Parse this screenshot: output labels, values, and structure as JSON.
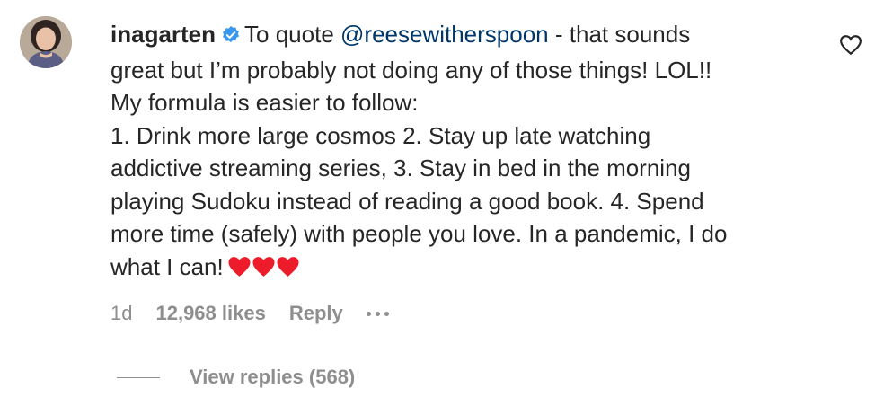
{
  "comment": {
    "username": "inagarten",
    "text_prefix": "To quote ",
    "mention": "@reesewitherspoon",
    "lines": [
      " - that sounds",
      "great but I’m probably not doing any of those things! LOL!!",
      "My formula is easier to follow:",
      "1. Drink more large cosmos 2. Stay up late watching",
      "addictive streaming series, 3. Stay in bed in the morning",
      "playing Sudoku instead of reading a good book. 4. Spend",
      "more time (safely) with people you love. In a pandemic, I do",
      "what I can!"
    ],
    "emoji": "❤️❤️❤️",
    "time": "1d",
    "likes": "12,968 likes",
    "reply_label": "Reply",
    "view_replies": "View replies (568)"
  },
  "colors": {
    "text": "#262626",
    "secondary": "#8e8e8e",
    "mention": "#00376b",
    "verified": "#3897f0",
    "heart": "#ed1c2b"
  },
  "icons": [
    "avatar",
    "verified-badge-icon",
    "heart-emoji-icon",
    "like-heart-icon",
    "more-options-icon"
  ]
}
